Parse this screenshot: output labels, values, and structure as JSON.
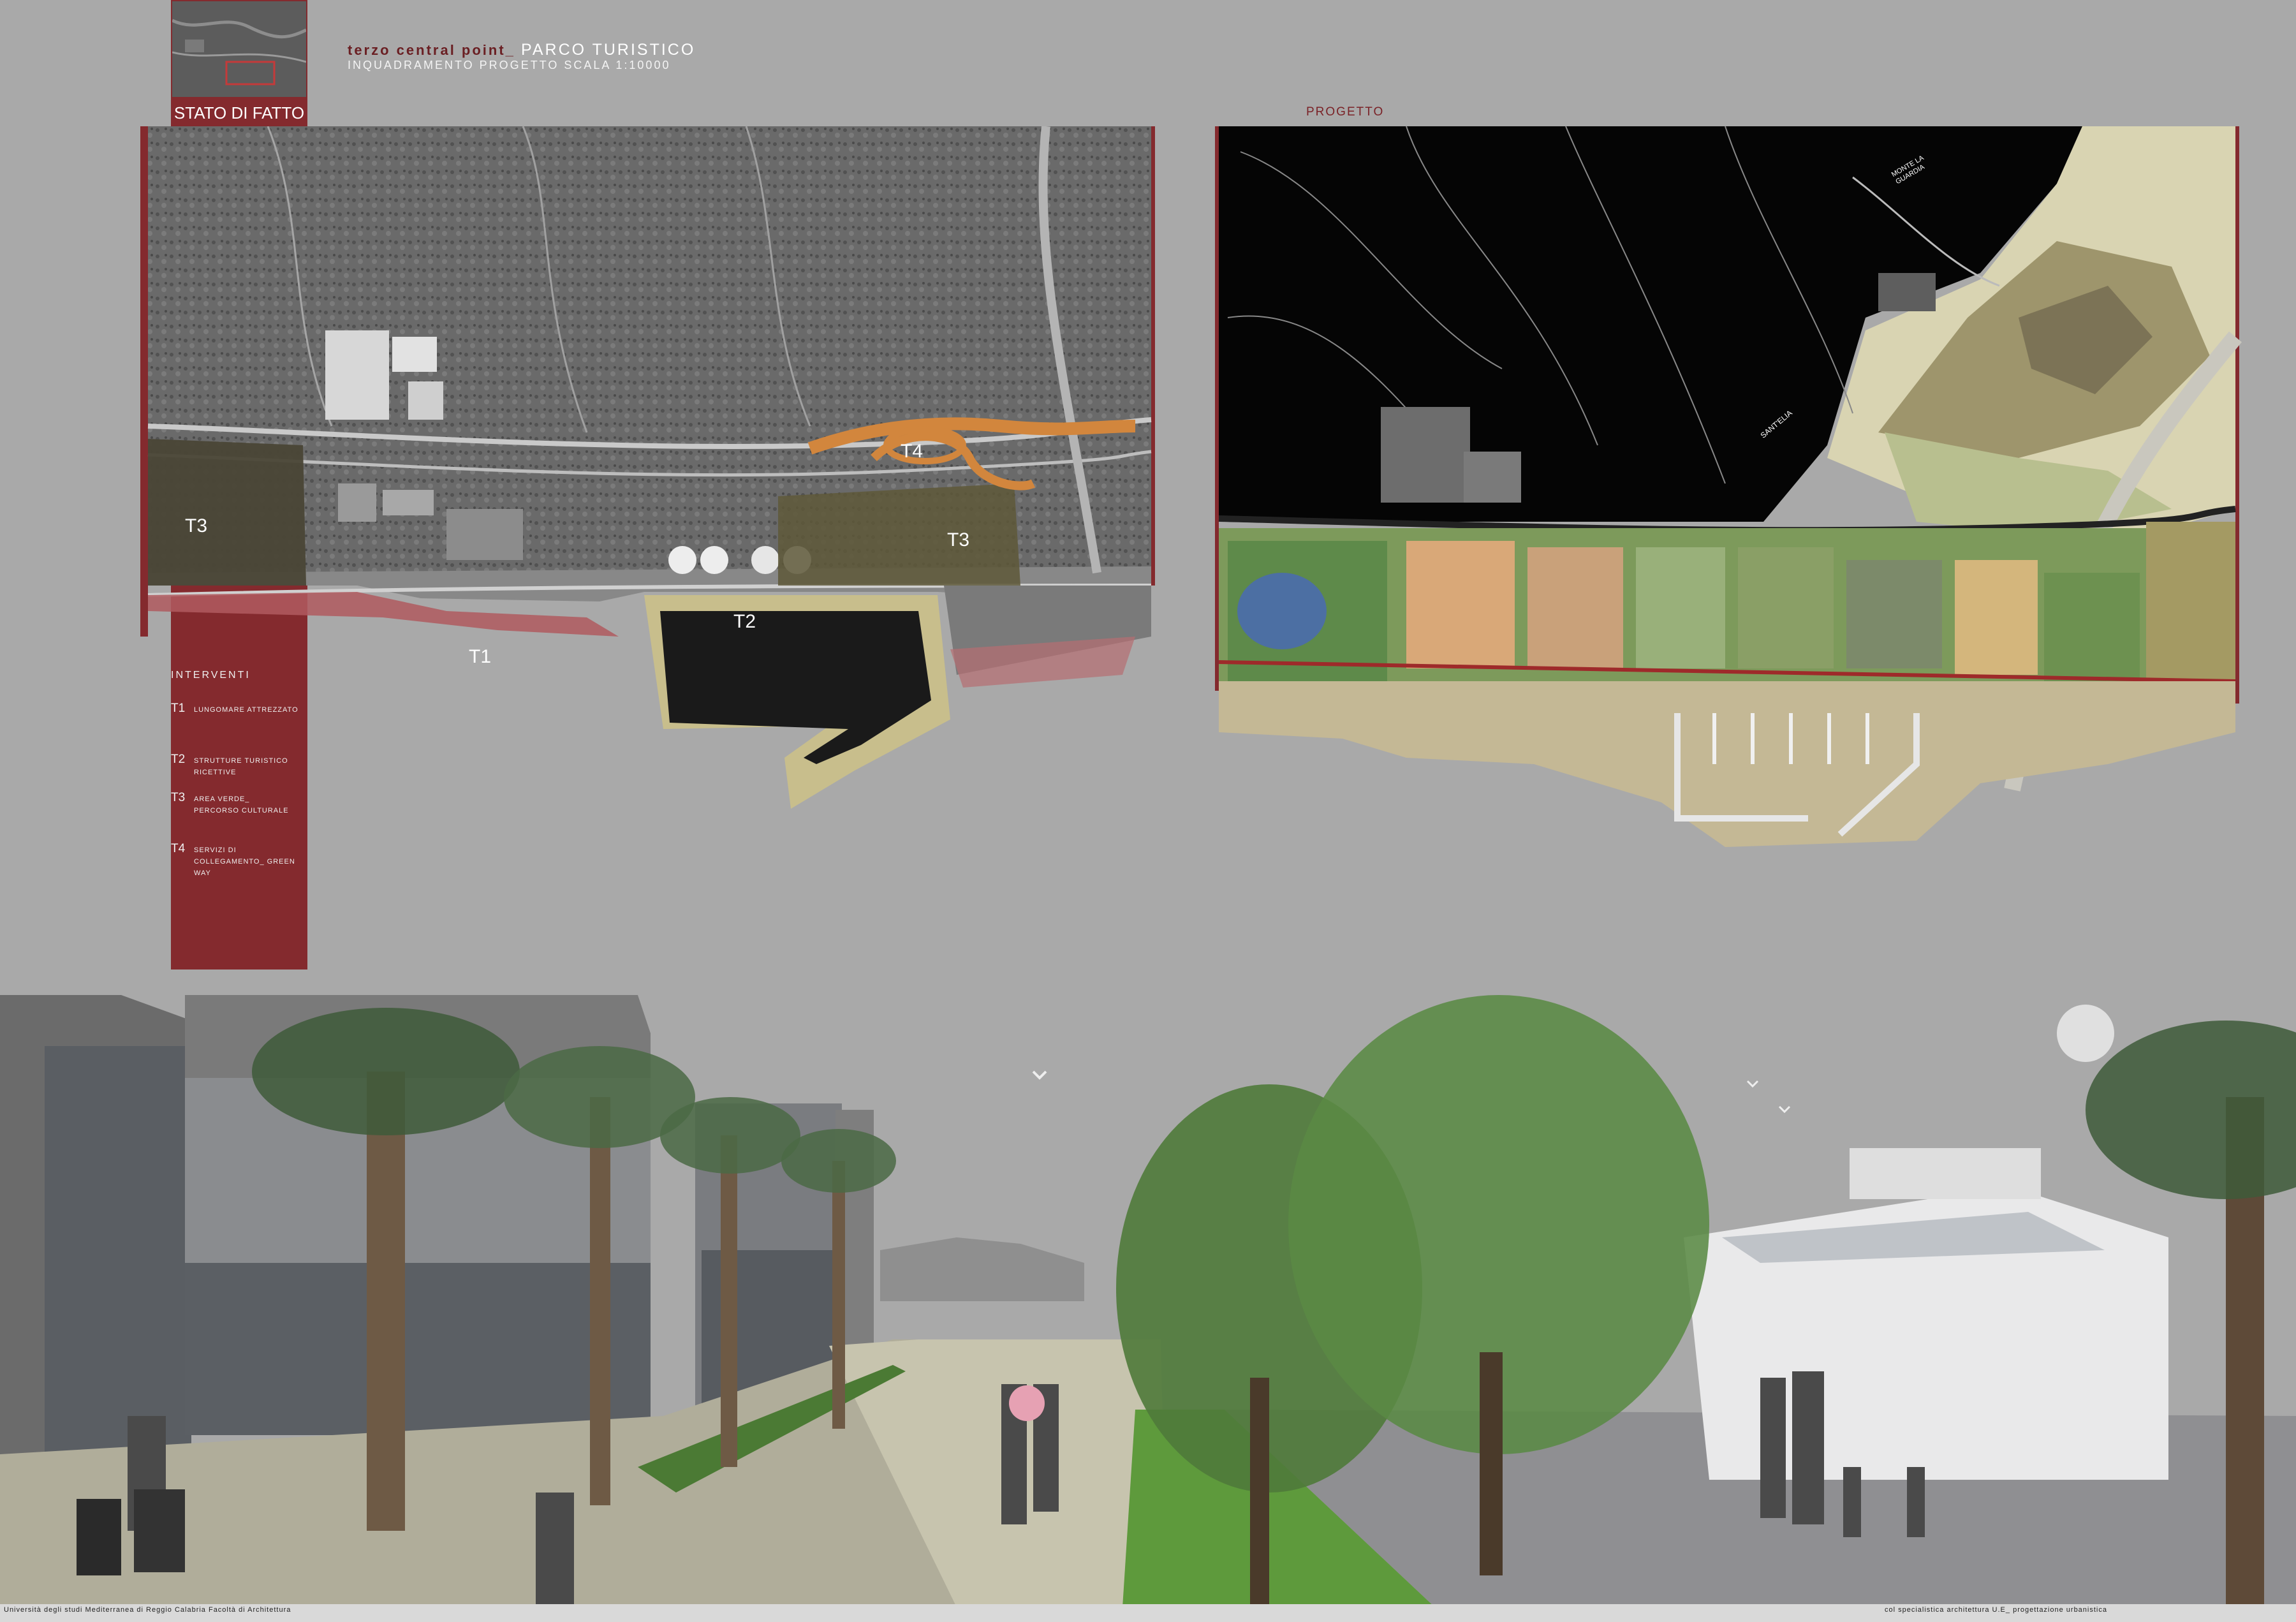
{
  "header": {
    "title_prefix": "terzo central point_",
    "title_main": "PARCO TURISTICO",
    "subtitle": "inquadramento progetto scala 1:10000"
  },
  "stato_di_fatto_label": "STATO DI FATTO",
  "progetto_label": "PROGETTO",
  "map_tags": {
    "t1": "T1",
    "t2": "T2",
    "t3a": "T3",
    "t3b": "T3",
    "t4": "T4"
  },
  "interventi": {
    "heading": "INTERVENTI",
    "items": [
      {
        "code": "T1",
        "desc": "lungomare attrezzato"
      },
      {
        "code": "T2",
        "desc": "strutture turistico ricettive"
      },
      {
        "code": "T3",
        "desc": "area verde_ percorso culturale"
      },
      {
        "code": "T4",
        "desc": "servizi di collegamento_ green way"
      }
    ]
  },
  "map_labels": {
    "monte": "MONTE LA GUARDIA",
    "santelia": "SANT'ELIA"
  },
  "footer": {
    "left": "Università degli studi Mediterranea di Reggio Calabria Facoltà di Architettura",
    "right": "col specialistica architettura U.E_ progettazione urbanistica"
  }
}
